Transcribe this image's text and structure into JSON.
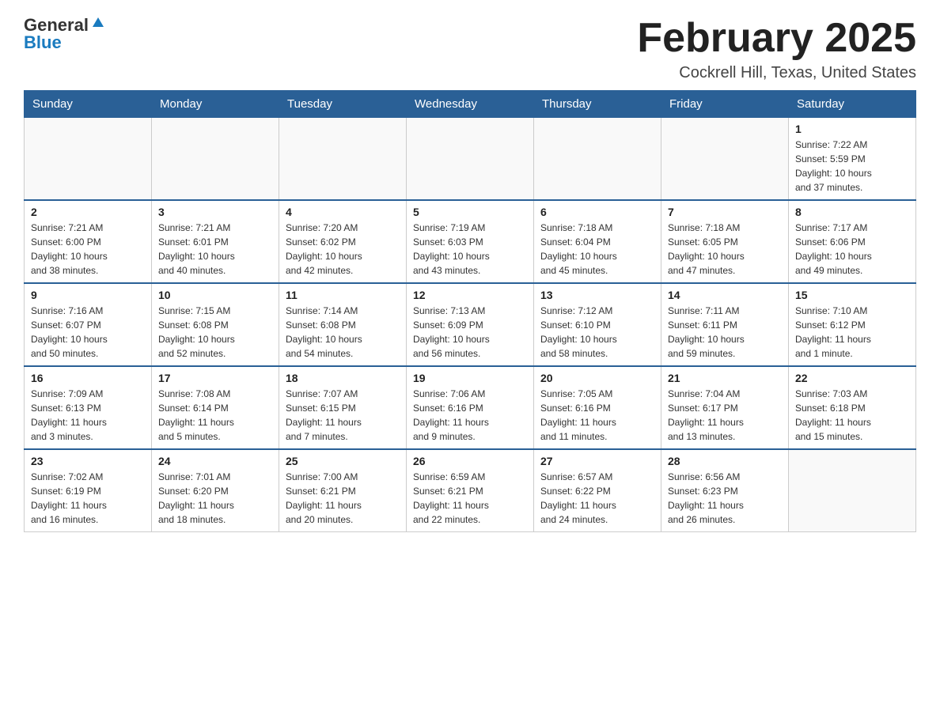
{
  "header": {
    "logo_general": "General",
    "logo_blue": "Blue",
    "month_title": "February 2025",
    "location": "Cockrell Hill, Texas, United States"
  },
  "days_of_week": [
    "Sunday",
    "Monday",
    "Tuesday",
    "Wednesday",
    "Thursday",
    "Friday",
    "Saturday"
  ],
  "weeks": [
    {
      "days": [
        {
          "number": "",
          "info": ""
        },
        {
          "number": "",
          "info": ""
        },
        {
          "number": "",
          "info": ""
        },
        {
          "number": "",
          "info": ""
        },
        {
          "number": "",
          "info": ""
        },
        {
          "number": "",
          "info": ""
        },
        {
          "number": "1",
          "info": "Sunrise: 7:22 AM\nSunset: 5:59 PM\nDaylight: 10 hours\nand 37 minutes."
        }
      ]
    },
    {
      "days": [
        {
          "number": "2",
          "info": "Sunrise: 7:21 AM\nSunset: 6:00 PM\nDaylight: 10 hours\nand 38 minutes."
        },
        {
          "number": "3",
          "info": "Sunrise: 7:21 AM\nSunset: 6:01 PM\nDaylight: 10 hours\nand 40 minutes."
        },
        {
          "number": "4",
          "info": "Sunrise: 7:20 AM\nSunset: 6:02 PM\nDaylight: 10 hours\nand 42 minutes."
        },
        {
          "number": "5",
          "info": "Sunrise: 7:19 AM\nSunset: 6:03 PM\nDaylight: 10 hours\nand 43 minutes."
        },
        {
          "number": "6",
          "info": "Sunrise: 7:18 AM\nSunset: 6:04 PM\nDaylight: 10 hours\nand 45 minutes."
        },
        {
          "number": "7",
          "info": "Sunrise: 7:18 AM\nSunset: 6:05 PM\nDaylight: 10 hours\nand 47 minutes."
        },
        {
          "number": "8",
          "info": "Sunrise: 7:17 AM\nSunset: 6:06 PM\nDaylight: 10 hours\nand 49 minutes."
        }
      ]
    },
    {
      "days": [
        {
          "number": "9",
          "info": "Sunrise: 7:16 AM\nSunset: 6:07 PM\nDaylight: 10 hours\nand 50 minutes."
        },
        {
          "number": "10",
          "info": "Sunrise: 7:15 AM\nSunset: 6:08 PM\nDaylight: 10 hours\nand 52 minutes."
        },
        {
          "number": "11",
          "info": "Sunrise: 7:14 AM\nSunset: 6:08 PM\nDaylight: 10 hours\nand 54 minutes."
        },
        {
          "number": "12",
          "info": "Sunrise: 7:13 AM\nSunset: 6:09 PM\nDaylight: 10 hours\nand 56 minutes."
        },
        {
          "number": "13",
          "info": "Sunrise: 7:12 AM\nSunset: 6:10 PM\nDaylight: 10 hours\nand 58 minutes."
        },
        {
          "number": "14",
          "info": "Sunrise: 7:11 AM\nSunset: 6:11 PM\nDaylight: 10 hours\nand 59 minutes."
        },
        {
          "number": "15",
          "info": "Sunrise: 7:10 AM\nSunset: 6:12 PM\nDaylight: 11 hours\nand 1 minute."
        }
      ]
    },
    {
      "days": [
        {
          "number": "16",
          "info": "Sunrise: 7:09 AM\nSunset: 6:13 PM\nDaylight: 11 hours\nand 3 minutes."
        },
        {
          "number": "17",
          "info": "Sunrise: 7:08 AM\nSunset: 6:14 PM\nDaylight: 11 hours\nand 5 minutes."
        },
        {
          "number": "18",
          "info": "Sunrise: 7:07 AM\nSunset: 6:15 PM\nDaylight: 11 hours\nand 7 minutes."
        },
        {
          "number": "19",
          "info": "Sunrise: 7:06 AM\nSunset: 6:16 PM\nDaylight: 11 hours\nand 9 minutes."
        },
        {
          "number": "20",
          "info": "Sunrise: 7:05 AM\nSunset: 6:16 PM\nDaylight: 11 hours\nand 11 minutes."
        },
        {
          "number": "21",
          "info": "Sunrise: 7:04 AM\nSunset: 6:17 PM\nDaylight: 11 hours\nand 13 minutes."
        },
        {
          "number": "22",
          "info": "Sunrise: 7:03 AM\nSunset: 6:18 PM\nDaylight: 11 hours\nand 15 minutes."
        }
      ]
    },
    {
      "days": [
        {
          "number": "23",
          "info": "Sunrise: 7:02 AM\nSunset: 6:19 PM\nDaylight: 11 hours\nand 16 minutes."
        },
        {
          "number": "24",
          "info": "Sunrise: 7:01 AM\nSunset: 6:20 PM\nDaylight: 11 hours\nand 18 minutes."
        },
        {
          "number": "25",
          "info": "Sunrise: 7:00 AM\nSunset: 6:21 PM\nDaylight: 11 hours\nand 20 minutes."
        },
        {
          "number": "26",
          "info": "Sunrise: 6:59 AM\nSunset: 6:21 PM\nDaylight: 11 hours\nand 22 minutes."
        },
        {
          "number": "27",
          "info": "Sunrise: 6:57 AM\nSunset: 6:22 PM\nDaylight: 11 hours\nand 24 minutes."
        },
        {
          "number": "28",
          "info": "Sunrise: 6:56 AM\nSunset: 6:23 PM\nDaylight: 11 hours\nand 26 minutes."
        },
        {
          "number": "",
          "info": ""
        }
      ]
    }
  ]
}
